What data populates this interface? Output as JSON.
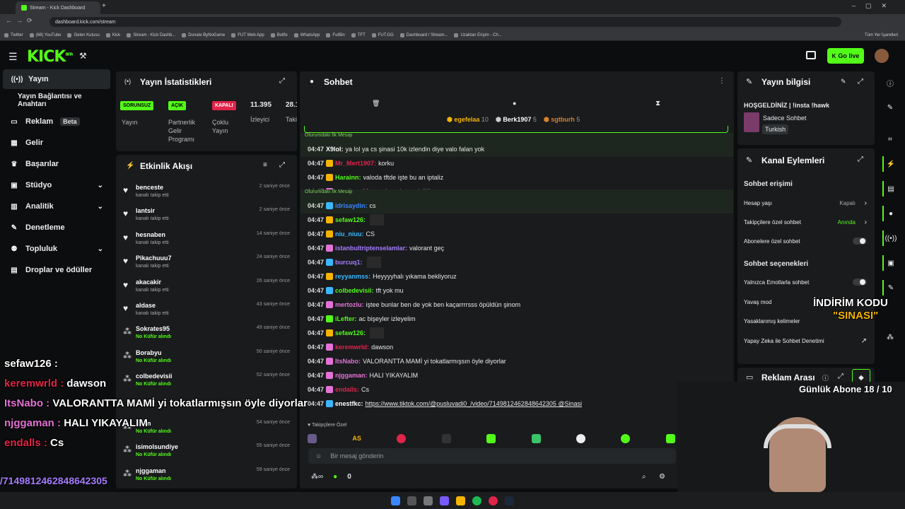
{
  "browser": {
    "tabs": [
      {
        "label": "Stream - Kick Dashboard"
      }
    ],
    "url": "dashboard.kick.com/stream",
    "bookmarks": [
      "Twitter",
      "(68) YouTube",
      "Gelen Kutusu",
      "Kick",
      "Stream - Kick Dashb...",
      "Donate ByNoGame",
      "FUT Web App",
      "Botfix",
      "WhatsApp",
      "FutBin",
      "TFT",
      "FUT.GG",
      "Dashboard / Stream...",
      "Uzaktan Erişim - Ch..."
    ],
    "bookmarks_right": "Tüm Yer İşaretleri"
  },
  "header": {
    "logo": "KICK",
    "logo_sup": "BETA",
    "go_live": "Go live"
  },
  "sidebar": {
    "items": [
      {
        "label": "Yayın",
        "icon": "broadcast-icon"
      },
      {
        "label": "Yayın Bağlantısı ve Anahtarı"
      },
      {
        "label": "Reklam",
        "badge": "Beta",
        "icon": "ad-icon"
      },
      {
        "label": "Gelir",
        "icon": "grid-icon"
      },
      {
        "label": "Başarılar",
        "icon": "trophy-icon"
      },
      {
        "label": "Stüdyo",
        "icon": "studio-icon"
      },
      {
        "label": "Analitik",
        "icon": "chart-icon"
      },
      {
        "label": "Denetleme",
        "icon": "wrench-icon"
      },
      {
        "label": "Topluluk",
        "icon": "people-icon"
      },
      {
        "label": "Droplar ve ödüller",
        "icon": "gift-icon"
      }
    ]
  },
  "stats": {
    "title": "Yayın İstatistikleri",
    "items": [
      {
        "badge": "SORUNSUZ",
        "label": "Yayın"
      },
      {
        "badge": "AÇIK",
        "label": "Partnerlik Gelir Programı"
      },
      {
        "badge": "KAPALI",
        "label": "Çoklu Yayın"
      },
      {
        "value": "11.395",
        "label": "İzleyici"
      },
      {
        "value": "28.1",
        "label": "Taki"
      }
    ]
  },
  "activity": {
    "title": "Etkinlik Akışı",
    "items": [
      {
        "name": "benceste",
        "sub": "kanalı takip etti",
        "time": "2 saniye önce"
      },
      {
        "name": "lantsir",
        "sub": "kanalı takip etti",
        "time": "2 saniye önce"
      },
      {
        "name": "hesnaben",
        "sub": "kanalı takip etti",
        "time": "14 saniye önce"
      },
      {
        "name": "Pikachuuu7",
        "sub": "kanalı takip etti",
        "time": "24 saniye önce"
      },
      {
        "name": "akacakir",
        "sub": "kanalı takip etti",
        "time": "26 saniye önce"
      },
      {
        "name": "aldase",
        "sub": "kanalı takip etti",
        "time": "43 saniye önce"
      },
      {
        "name": "Sokrates95",
        "sub": "No Küfür alındı",
        "time": "49 saniye önce"
      },
      {
        "name": "Borabyu",
        "sub": "No Küfür alındı",
        "time": "50 saniye önce"
      },
      {
        "name": "colbedevisii",
        "sub": "No Küfür alındı",
        "time": "52 saniye önce"
      },
      {
        "name": "",
        "sub": "",
        "time": ""
      },
      {
        "name": "...ton",
        "sub": "No Küfür alındı",
        "time": "54 saniye önce"
      },
      {
        "name": "isimolsundiye",
        "sub": "No Küfür alındı",
        "time": "55 saniye önce"
      },
      {
        "name": "njggaman",
        "sub": "No Küfür alındı",
        "time": "59 saniye önce"
      }
    ]
  },
  "chat": {
    "title": "Sohbet",
    "top_gifters": [
      {
        "name": "egefelaa",
        "count": "10"
      },
      {
        "name": "Berk1907",
        "count": "5"
      },
      {
        "name": "sgtburh",
        "count": "5"
      }
    ],
    "first_message_label": "Oturumdaki İlk Mesajı",
    "messages": [
      {
        "time": "04:47",
        "user": "X9lol:",
        "color": "#ffffff",
        "text": "ya lol ya cs şinasi 10k izlendin diye valo falan yok",
        "first": true
      },
      {
        "time": "04:47",
        "user": "Mr_Mert1907:",
        "color": "#e0244a",
        "text": "korku"
      },
      {
        "time": "04:47",
        "user": "Harainn:",
        "color": "#53fc18",
        "text": "valoda tftde işte bu an iptaliz"
      },
      {
        "time": "04:47",
        "user": "userirem32:",
        "color": "#e472d6",
        "text": "south park sessizliği"
      },
      {
        "time": "04:47",
        "user": "idrisaydin:",
        "color": "#3a86ff",
        "text": "cs",
        "first": true
      },
      {
        "time": "04:47",
        "user": "sefaw126:",
        "color": "#53fc18",
        "text": ""
      },
      {
        "time": "04:47",
        "user": "niu_niuu:",
        "color": "#3ab7ff",
        "text": "CS"
      },
      {
        "time": "04:47",
        "user": "istanbultriptenselamlar:",
        "color": "#a77bff",
        "text": "valorant geç"
      },
      {
        "time": "04:47",
        "user": "burcuq1:",
        "color": "#a77bff",
        "text": ""
      },
      {
        "time": "04:47",
        "user": "reyyanmss:",
        "color": "#3ab7ff",
        "text": "Heyyyyhalı yıkama bekliyoruz"
      },
      {
        "time": "04:47",
        "user": "colbedevisii:",
        "color": "#53fc18",
        "text": "tft yok mu"
      },
      {
        "time": "04:47",
        "user": "mertozlu:",
        "color": "#e472d6",
        "text": "iştee bunlar ben de yok ben kaçarrrrsss öpüldün şinom"
      },
      {
        "time": "04:47",
        "user": "iLefter:",
        "color": "#53fc18",
        "text": "ac bişeyler izleyelim"
      },
      {
        "time": "04:47",
        "user": "sefaw126:",
        "color": "#53fc18",
        "text": ""
      },
      {
        "time": "04:47",
        "user": "keremwrld:",
        "color": "#e0244a",
        "text": "dawson"
      },
      {
        "time": "04:47",
        "user": "ItsNabo:",
        "color": "#e472d6",
        "text": "VALORANTTA MAMİ yi tokatlarmışsın öyle diyorlar"
      },
      {
        "time": "04:47",
        "user": "njggaman:",
        "color": "#e472d6",
        "text": "HALI YIKAYALIM"
      },
      {
        "time": "04:47",
        "user": "endalls:",
        "color": "#e0244a",
        "text": "Cs"
      },
      {
        "time": "04:47",
        "user": "enestfkc:",
        "color": "#ffffff",
        "text": "https://www.tiktok.com/@pusluvadi0_/video/7149812462848642305 @Sinasi"
      }
    ],
    "followers_only": "Takipçilere Özel",
    "input_placeholder": "Bir mesaj gönderin",
    "points": "0"
  },
  "stream_info": {
    "title": "Yayın bilgisi",
    "stream_title": "HOŞGELDİNİZ | !insta !hawk",
    "category": "Sadece Sohbet",
    "language": "Turkish"
  },
  "channel_actions": {
    "title": "Kanal Eylemleri",
    "chat_access": "Sohbet erişimi",
    "rows1": [
      {
        "label": "Hesap yaşı",
        "value": "Kapalı"
      },
      {
        "label": "Takipçilere özel sohbet",
        "value": "Anında"
      },
      {
        "label": "Abonelere özel sohbet"
      }
    ],
    "chat_options": "Sohbet seçenekleri",
    "rows2": [
      {
        "label": "Yalnızca Emotlarla sohbet"
      },
      {
        "label": "Yavaş mod"
      },
      {
        "label": "Yasaklanmış kelimeler"
      },
      {
        "label": "Yapay Zeka ile Sohbet Denetimi"
      }
    ],
    "ad_break": "Reklam Arası"
  },
  "overlay": {
    "lines": [
      {
        "user": "sefaw126 :",
        "text": "",
        "color": "#ffffff"
      },
      {
        "user": "keremwrld :",
        "text": "dawson",
        "color": "#e0244a"
      },
      {
        "user": "ItsNabo :",
        "text": "VALORANTTA MAMİ yi tokatlarmışsın öyle diyorlar",
        "color": "#e472d6"
      },
      {
        "user": "njggaman :",
        "text": "HALI YIKAYALIM",
        "color": "#e472d6"
      },
      {
        "user": "endalls :",
        "text": "Cs",
        "color": "#e0244a"
      }
    ],
    "url_tail": "/7149812462848642305",
    "promo_top": "İNDİRİM KODU",
    "promo_code": "\"SINASI\"",
    "sub_goal": "Günlük Abone 18 / 10"
  }
}
